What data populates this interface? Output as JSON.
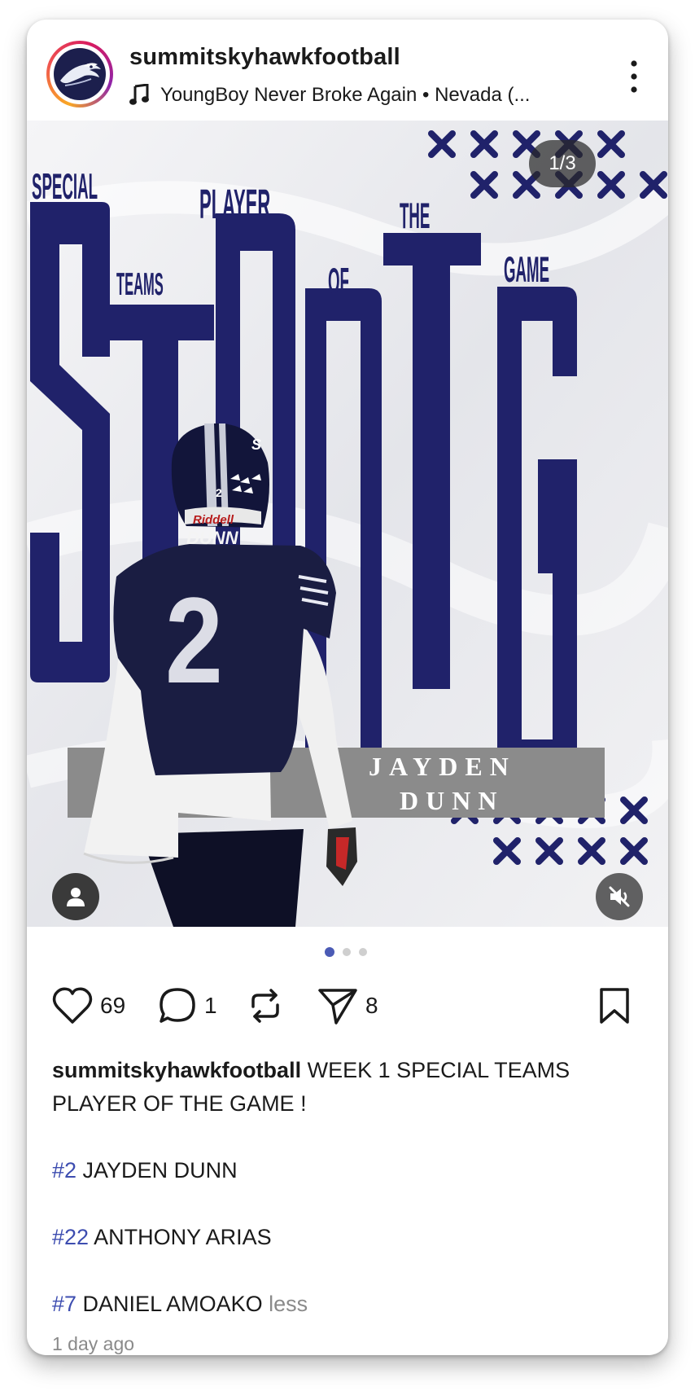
{
  "header": {
    "username": "summitskyhawkfootball",
    "music": "YoungBoy Never Broke Again • Nevada (...",
    "icons": {
      "music": "music-note-icon",
      "more": "more-vertical-icon",
      "avatar": "skyhawk-logo"
    }
  },
  "post": {
    "counter": "1/3",
    "graphic": {
      "word_special": "SPECIAL",
      "word_teams": "TEAMS",
      "word_player": "PLAYER",
      "word_of": "OF",
      "word_the": "THE",
      "word_game": "GAME",
      "big_word": "STRONG",
      "name_first": "JAYDEN",
      "name_last": "DUNN",
      "jersey_name": "DUNN",
      "jersey_number": "2",
      "helmet_brand": "Riddell"
    },
    "colors": {
      "navy": "#20226a",
      "banner": "#8b8b8b",
      "background": "#ecedf0"
    },
    "icons": {
      "tag": "person-tag-icon",
      "mute": "volume-mute-icon"
    }
  },
  "carousel": {
    "count": 3,
    "active_index": 0
  },
  "actions": {
    "likes": "69",
    "comments": "1",
    "shares": "8",
    "icons": [
      "heart-icon",
      "comment-icon",
      "repost-icon",
      "send-icon",
      "bookmark-icon"
    ]
  },
  "caption": {
    "username": "summitskyhawkfootball",
    "text": " WEEK 1 SPECIAL TEAMS PLAYER OF THE GAME !",
    "lines": [
      {
        "tag": "#2",
        "text": " JAYDEN DUNN"
      },
      {
        "tag": "#22",
        "text": " ANTHONY ARIAS"
      },
      {
        "tag": "#7",
        "text": " DANIEL AMOAKO"
      }
    ],
    "less": " less"
  },
  "timestamp": "1 day ago"
}
